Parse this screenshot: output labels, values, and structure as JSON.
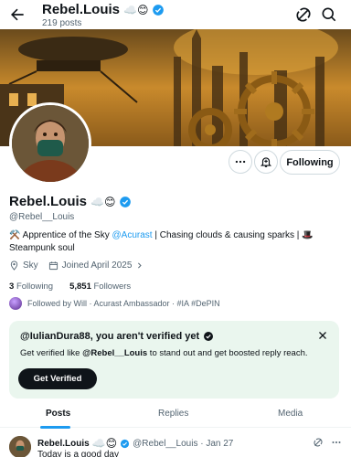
{
  "header": {
    "title": "Rebel.Louis",
    "posts_count": "219 posts",
    "name_emojis": "☁️😊"
  },
  "profile": {
    "name": "Rebel.Louis",
    "name_emojis": "☁️😊",
    "handle": "@Rebel__Louis",
    "bio_prefix": "⚒️ Apprentice of the Sky ",
    "bio_mention": "@Acurast",
    "bio_suffix": " | Chasing clouds & causing sparks | 🎩",
    "bio_line2": "Steampunk soul",
    "location": "Sky",
    "joined": "Joined April 2025",
    "following_count": "3",
    "following_label": "Following",
    "followers_count": "5,851",
    "followers_label": "Followers",
    "followed_by": "Followed by Will · Acurast Ambassador · #IA #DePIN"
  },
  "actions": {
    "follow_label": "Following"
  },
  "verify_card": {
    "title": "@IulianDura88, you aren't verified yet",
    "text_prefix": "Get verified like ",
    "text_handle": "@Rebel__Louis",
    "text_suffix": " to stand out and get boosted reply reach.",
    "button_label": "Get Verified"
  },
  "tabs": [
    {
      "label": "Posts",
      "active": true
    },
    {
      "label": "Replies",
      "active": false
    },
    {
      "label": "Media",
      "active": false
    }
  ],
  "post": {
    "name": "Rebel.Louis",
    "name_emojis": "☁️😊",
    "handle_date": "@Rebel__Louis · Jan 27",
    "text": "Today is a good day"
  },
  "colors": {
    "accent": "#1d9bf0",
    "card_bg": "#eaf6ee",
    "text_secondary": "#536471"
  },
  "icons": [
    "back-arrow-icon",
    "grok-icon",
    "search-icon",
    "more-icon",
    "notify-bell-icon",
    "verified-badge-icon",
    "location-icon",
    "calendar-icon",
    "close-icon"
  ]
}
